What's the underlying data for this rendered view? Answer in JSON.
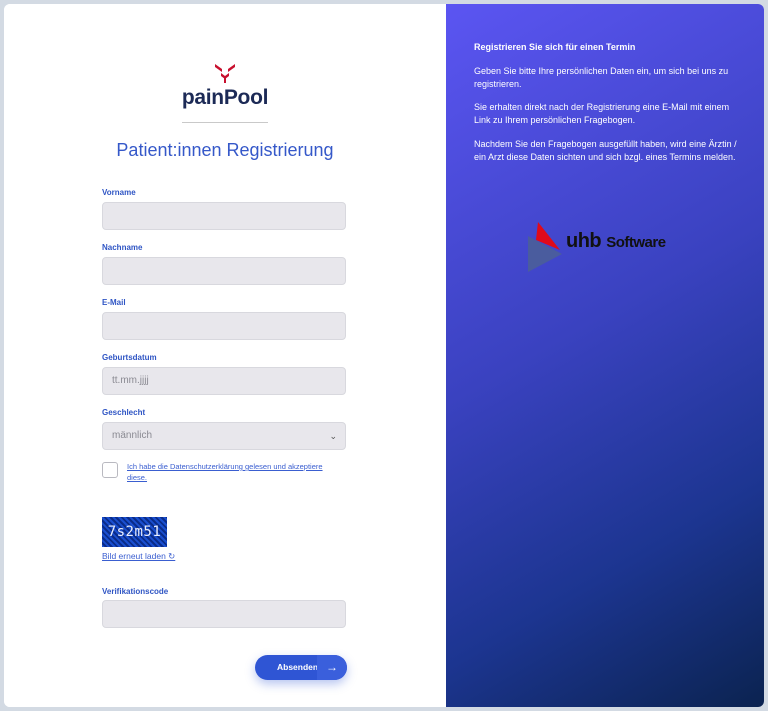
{
  "logo": {
    "brand_part1": "pain",
    "brand_part2": "Pool"
  },
  "title": "Patient:innen Registrierung",
  "form": {
    "firstname_label": "Vorname",
    "lastname_label": "Nachname",
    "email_label": "E-Mail",
    "birthdate_label": "Geburtsdatum",
    "birthdate_placeholder": "tt.mm.jjjj",
    "gender_label": "Geschlecht",
    "gender_value": "männlich",
    "consent_text": "Ich habe die Datenschutzerklärung gelesen und akzeptiere diese.",
    "captcha_text": "7s2m51",
    "reload_text": "Bild erneut laden ↻",
    "verification_label": "Verifikationscode",
    "submit_label": "Absenden"
  },
  "info": {
    "heading": "Registrieren Sie sich für einen Termin",
    "para1": "Geben Sie bitte Ihre persönlichen Daten ein, um sich bei uns zu registrieren.",
    "para2": "Sie erhalten direkt nach der Registrierung eine E-Mail mit einem Link zu Ihrem persönlichen Fragebogen.",
    "para3": "Nachdem Sie den Fragebogen ausgefüllt haben, wird eine Ärztin / ein Arzt diese Daten sichten und sich bzgl. eines Termins melden.",
    "partner_logo_main": "uhb",
    "partner_logo_sub": "Software"
  },
  "colors": {
    "accent": "#3558c9",
    "brand_red": "#c8102e",
    "gradient_start": "#5b55f2",
    "gradient_end": "#0b2350"
  },
  "icons": {
    "select": "chevron-down-icon",
    "submit": "arrow-right-icon"
  }
}
